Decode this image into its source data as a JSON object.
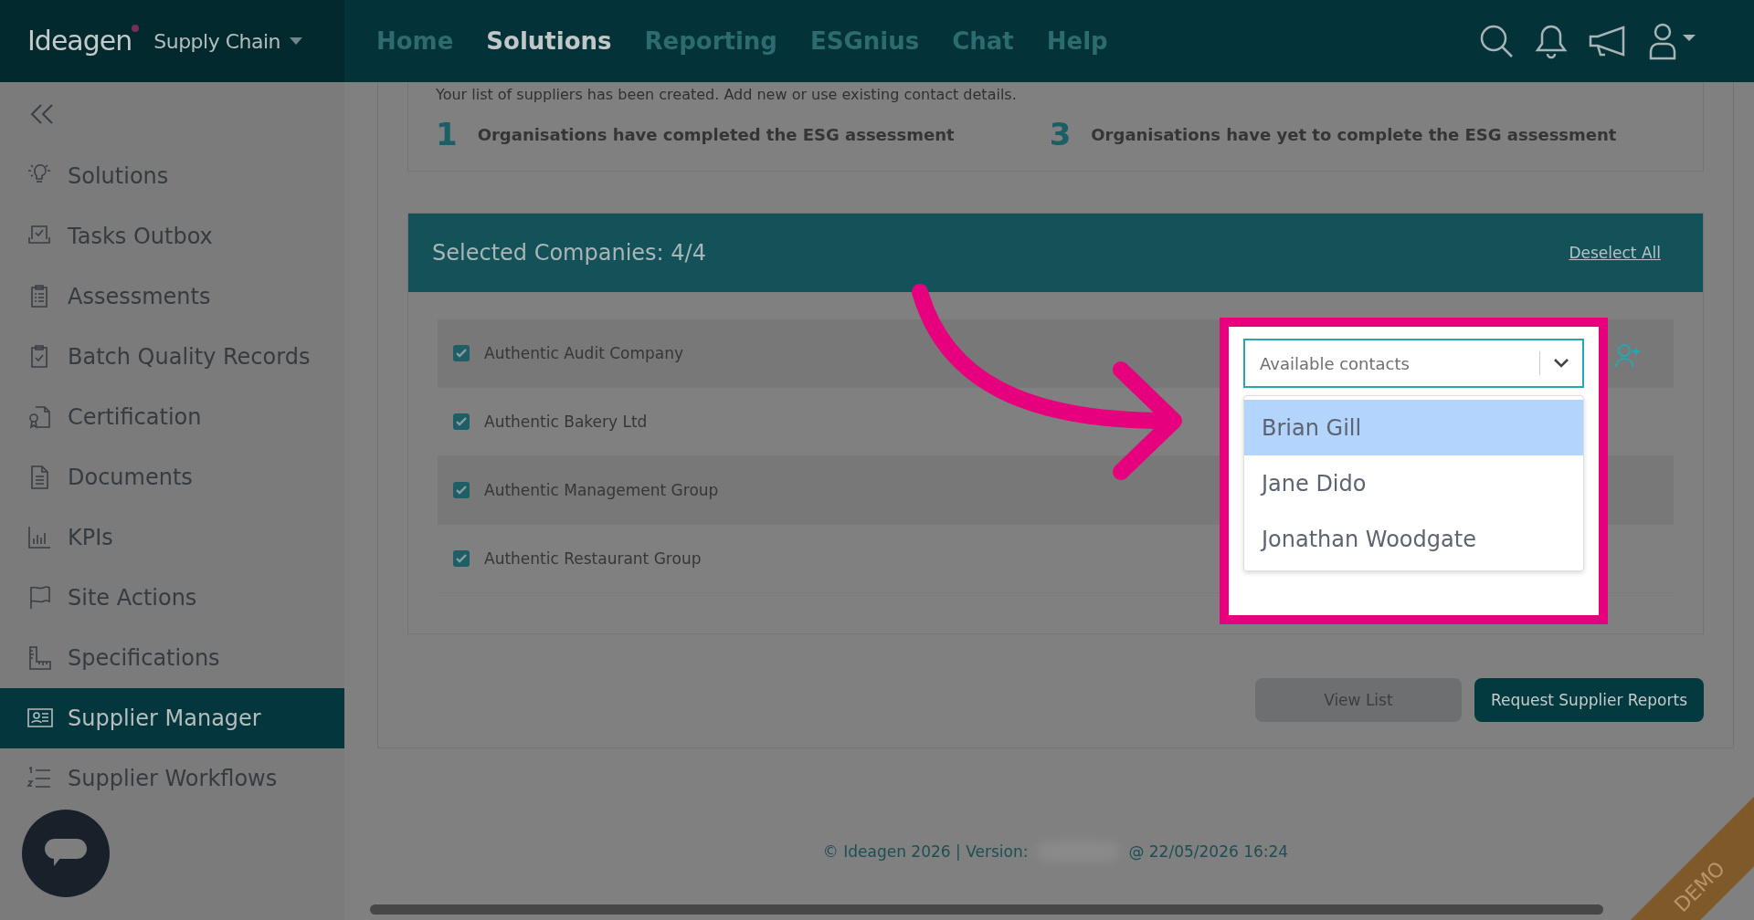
{
  "header": {
    "logo": "Ideagen",
    "product": "Supply Chain",
    "nav": [
      {
        "label": "Home",
        "selected": false
      },
      {
        "label": "Solutions",
        "selected": true
      },
      {
        "label": "Reporting",
        "selected": false
      },
      {
        "label": "ESGnius",
        "selected": false
      },
      {
        "label": "Chat",
        "selected": false
      },
      {
        "label": "Help",
        "selected": false
      }
    ]
  },
  "sidebar": {
    "items": [
      {
        "label": "Solutions",
        "selected": false
      },
      {
        "label": "Tasks Outbox",
        "selected": false
      },
      {
        "label": "Assessments",
        "selected": false
      },
      {
        "label": "Batch Quality Records",
        "selected": false
      },
      {
        "label": "Certification",
        "selected": false
      },
      {
        "label": "Documents",
        "selected": false
      },
      {
        "label": "KPIs",
        "selected": false
      },
      {
        "label": "Site Actions",
        "selected": false
      },
      {
        "label": "Specifications",
        "selected": false
      },
      {
        "label": "Supplier Manager",
        "selected": true
      },
      {
        "label": "Supplier Workflows",
        "selected": false
      }
    ]
  },
  "summary": {
    "intro": "Your list of suppliers has been created. Add new or use existing contact details.",
    "stats": [
      {
        "count": "1",
        "label": "Organisations have completed the ESG assessment"
      },
      {
        "count": "3",
        "label": "Organisations have yet to complete the ESG assessment"
      }
    ]
  },
  "selection": {
    "title": "Selected Companies: 4/4",
    "deselect": "Deselect All",
    "companies": [
      {
        "name": "Authentic Audit Company",
        "checked": true
      },
      {
        "name": "Authentic Bakery Ltd",
        "checked": true
      },
      {
        "name": "Authentic Management Group",
        "checked": true
      },
      {
        "name": "Authentic Restaurant Group",
        "checked": true
      }
    ]
  },
  "contact_picker": {
    "placeholder": "Available contacts",
    "options": [
      {
        "label": "Brian Gill",
        "selected": true
      },
      {
        "label": "Jane Dido",
        "selected": false
      },
      {
        "label": "Jonathan Woodgate",
        "selected": false
      }
    ]
  },
  "buttons": [
    "View List",
    "Request Supplier Reports"
  ],
  "footer": {
    "copyright": "© Ideagen 2026 | Version:",
    "timestamp": "@ 22/05/2026 16:24"
  },
  "demo_badge": "DEMO"
}
